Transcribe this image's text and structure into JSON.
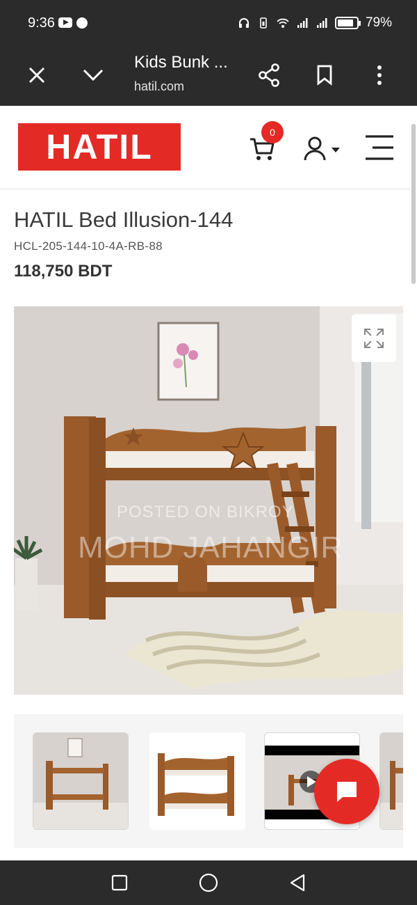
{
  "status_bar": {
    "time": "9:36",
    "battery": "79%",
    "icons": [
      "youtube-icon",
      "messenger-icon",
      "headset-icon",
      "battery-saver-icon",
      "wifi-icon",
      "signal-icon",
      "signal-icon",
      "battery-icon"
    ]
  },
  "browser": {
    "title": "Kids Bunk ...",
    "url": "hatil.com",
    "icons": [
      "close-icon",
      "chevron-down-icon",
      "share-icon",
      "bookmark-icon",
      "more-vert-icon"
    ]
  },
  "site": {
    "logo_text": "HATIL",
    "cart_count": "0",
    "brand_color": "#e42a25",
    "icons": [
      "cart-icon",
      "user-icon",
      "menu-icon"
    ]
  },
  "product": {
    "title": "HATIL Bed Illusion-144",
    "sku": "HCL-205-144-10-4A-RB-88",
    "price": "118,750 BDT"
  },
  "image": {
    "watermark_line1": "POSTED ON BIKROY",
    "watermark_line2": "MOHD JAHANGIR"
  },
  "thumbnails": [
    "room-bunk-bed",
    "bunk-bed-white-bg",
    "video-thumbnail",
    "room-bunk-bed-partial"
  ],
  "nav": {
    "icons": [
      "recents-icon",
      "home-icon",
      "back-icon"
    ]
  }
}
